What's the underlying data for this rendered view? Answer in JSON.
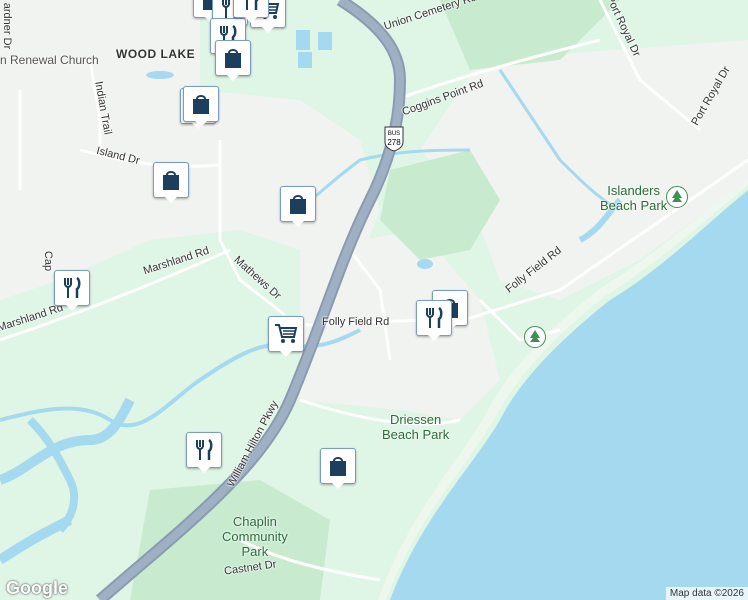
{
  "map": {
    "roads": {
      "union_cemetery": "Union Cemetery Rd",
      "coggins_point": "Coggins Point Rd",
      "port_royal_1": "Port Royal Dr",
      "port_royal_2": "Port Royal Dr",
      "island_dr": "Island Dr",
      "indian_trail": "Indian Trail",
      "marshland_1": "Marshland Rd",
      "marshland_2": "Marshland Rd",
      "mathews": "Mathews Dr",
      "folly_field_1": "Folly Field Rd",
      "folly_field_2": "Folly Field Rd",
      "william_hilton": "William Hilton Pkwy",
      "castnet": "Castnet Dr",
      "gardner_partial": "ardner Dr",
      "cap_partial": "Cap"
    },
    "places": {
      "wood_lake": "WOOD LAKE",
      "church": "n Renewal Church"
    },
    "parks": {
      "islanders_1": "Islanders",
      "islanders_2": "Beach Park",
      "driessen_1": "Driessen",
      "driessen_2": "Beach Park",
      "chaplin_1": "Chaplin",
      "chaplin_2": "Community",
      "chaplin_3": "Park"
    },
    "shield": {
      "bus": "BUS",
      "number": "278"
    },
    "pins": [
      {
        "type": "shopping",
        "icon": "shopping-bag-icon"
      },
      {
        "type": "restaurant",
        "icon": "restaurant-icon"
      },
      {
        "type": "grocery",
        "icon": "shopping-cart-icon"
      },
      {
        "type": "restaurant",
        "icon": "restaurant-icon"
      },
      {
        "type": "shopping",
        "icon": "shopping-bag-icon"
      },
      {
        "type": "restaurant",
        "icon": "restaurant-icon"
      },
      {
        "type": "restaurant",
        "icon": "restaurant-icon"
      },
      {
        "type": "shopping",
        "icon": "shopping-bag-icon"
      },
      {
        "type": "shopping",
        "icon": "shopping-bag-icon"
      },
      {
        "type": "shopping",
        "icon": "shopping-bag-icon"
      },
      {
        "type": "restaurant",
        "icon": "restaurant-icon"
      },
      {
        "type": "shopping",
        "icon": "shopping-bag-icon"
      },
      {
        "type": "grocery",
        "icon": "shopping-cart-icon"
      },
      {
        "type": "restaurant",
        "icon": "restaurant-icon"
      }
    ],
    "colors": {
      "land": "#dff5e6",
      "water": "#a4d9f0",
      "highway": "#8a9bb0",
      "pin_icon": "#1d3f5e",
      "park": "#3f8f52"
    },
    "attribution": "Map data ©2026",
    "logo": "Google"
  }
}
